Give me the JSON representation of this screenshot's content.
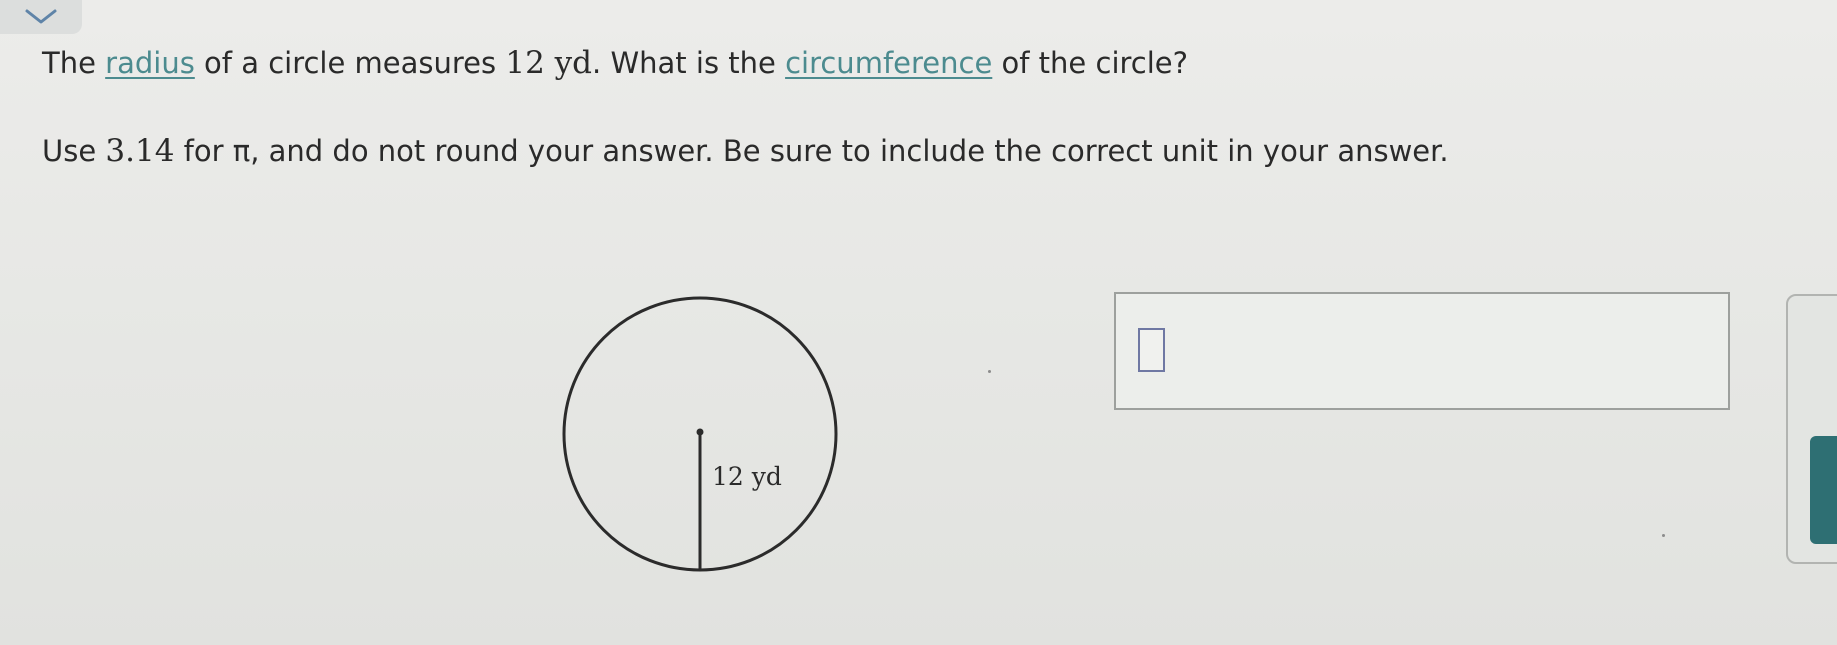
{
  "header": {
    "collapse_icon": "chevron-down-icon"
  },
  "question": {
    "prefix": "The ",
    "radius_link": "radius",
    "middle": " of a circle measures ",
    "measure": "12 yd",
    "middle2": ". What is the ",
    "circumference_link": "circumference",
    "suffix": " of the circle?"
  },
  "instruction": {
    "prefix": "Use ",
    "pi_value": "3.14",
    "middle": " for π, and do not round your answer. Be sure to include the correct unit in your answer."
  },
  "figure": {
    "radius_label": "12 yd"
  },
  "answer": {
    "value": "",
    "placeholder": ""
  },
  "colors": {
    "link": "#4c8b8f",
    "accent": "#2e6f73",
    "input_cursor_border": "#6f78a3"
  }
}
